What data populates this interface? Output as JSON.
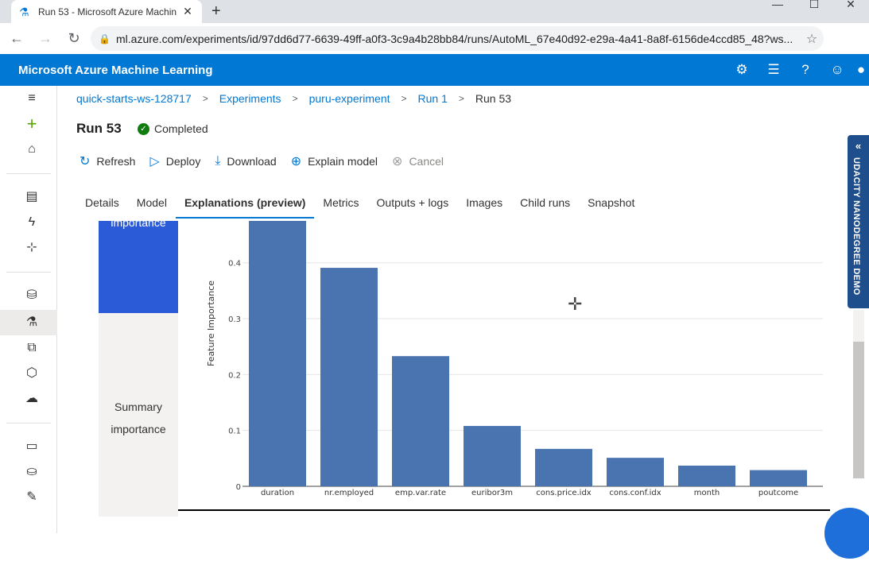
{
  "browser": {
    "tab_title": "Run 53 - Microsoft Azure Machin",
    "url": "ml.azure.com/experiments/id/97dd6d77-6639-49ff-a0f3-3c9a4b28bb84/runs/AutoML_67e40d92-e29a-4a41-8a8f-6156de4ccd85_48?ws..."
  },
  "header": {
    "brand": "Microsoft Azure Machine Learning"
  },
  "breadcrumb": [
    {
      "label": "quick-starts-ws-128717"
    },
    {
      "label": "Experiments"
    },
    {
      "label": "puru-experiment"
    },
    {
      "label": "Run 1"
    },
    {
      "label": "Run 53"
    }
  ],
  "run": {
    "title": "Run 53",
    "status": "Completed"
  },
  "toolbar": {
    "refresh": "Refresh",
    "deploy": "Deploy",
    "download": "Download",
    "explain": "Explain model",
    "cancel": "Cancel"
  },
  "tabs": [
    "Details",
    "Model",
    "Explanations (preview)",
    "Metrics",
    "Outputs + logs",
    "Images",
    "Child runs",
    "Snapshot"
  ],
  "explanation": {
    "selected_label": "importance",
    "summary_label_1": "Summary",
    "summary_label_2": "importance"
  },
  "side_banner": "UDACITY NANODEGREE DEMO",
  "colors": {
    "azure_blue": "#0078d4",
    "bar": "#4a74b0",
    "selected_panel": "#2b5bd7",
    "success": "#107c10"
  },
  "chart_data": {
    "type": "bar",
    "title": "",
    "xlabel": "",
    "ylabel": "Feature Importance",
    "categories": [
      "duration",
      "nr.employed",
      "emp.var.rate",
      "euribor3m",
      "cons.price.idx",
      "cons.conf.idx",
      "month",
      "poutcome"
    ],
    "values": [
      0.475,
      0.391,
      0.233,
      0.108,
      0.067,
      0.051,
      0.037,
      0.029
    ],
    "yticks": [
      "0",
      "0.1",
      "0.2",
      "0.3",
      "0.4"
    ],
    "ylim": [
      0,
      0.475
    ],
    "grid": true
  }
}
